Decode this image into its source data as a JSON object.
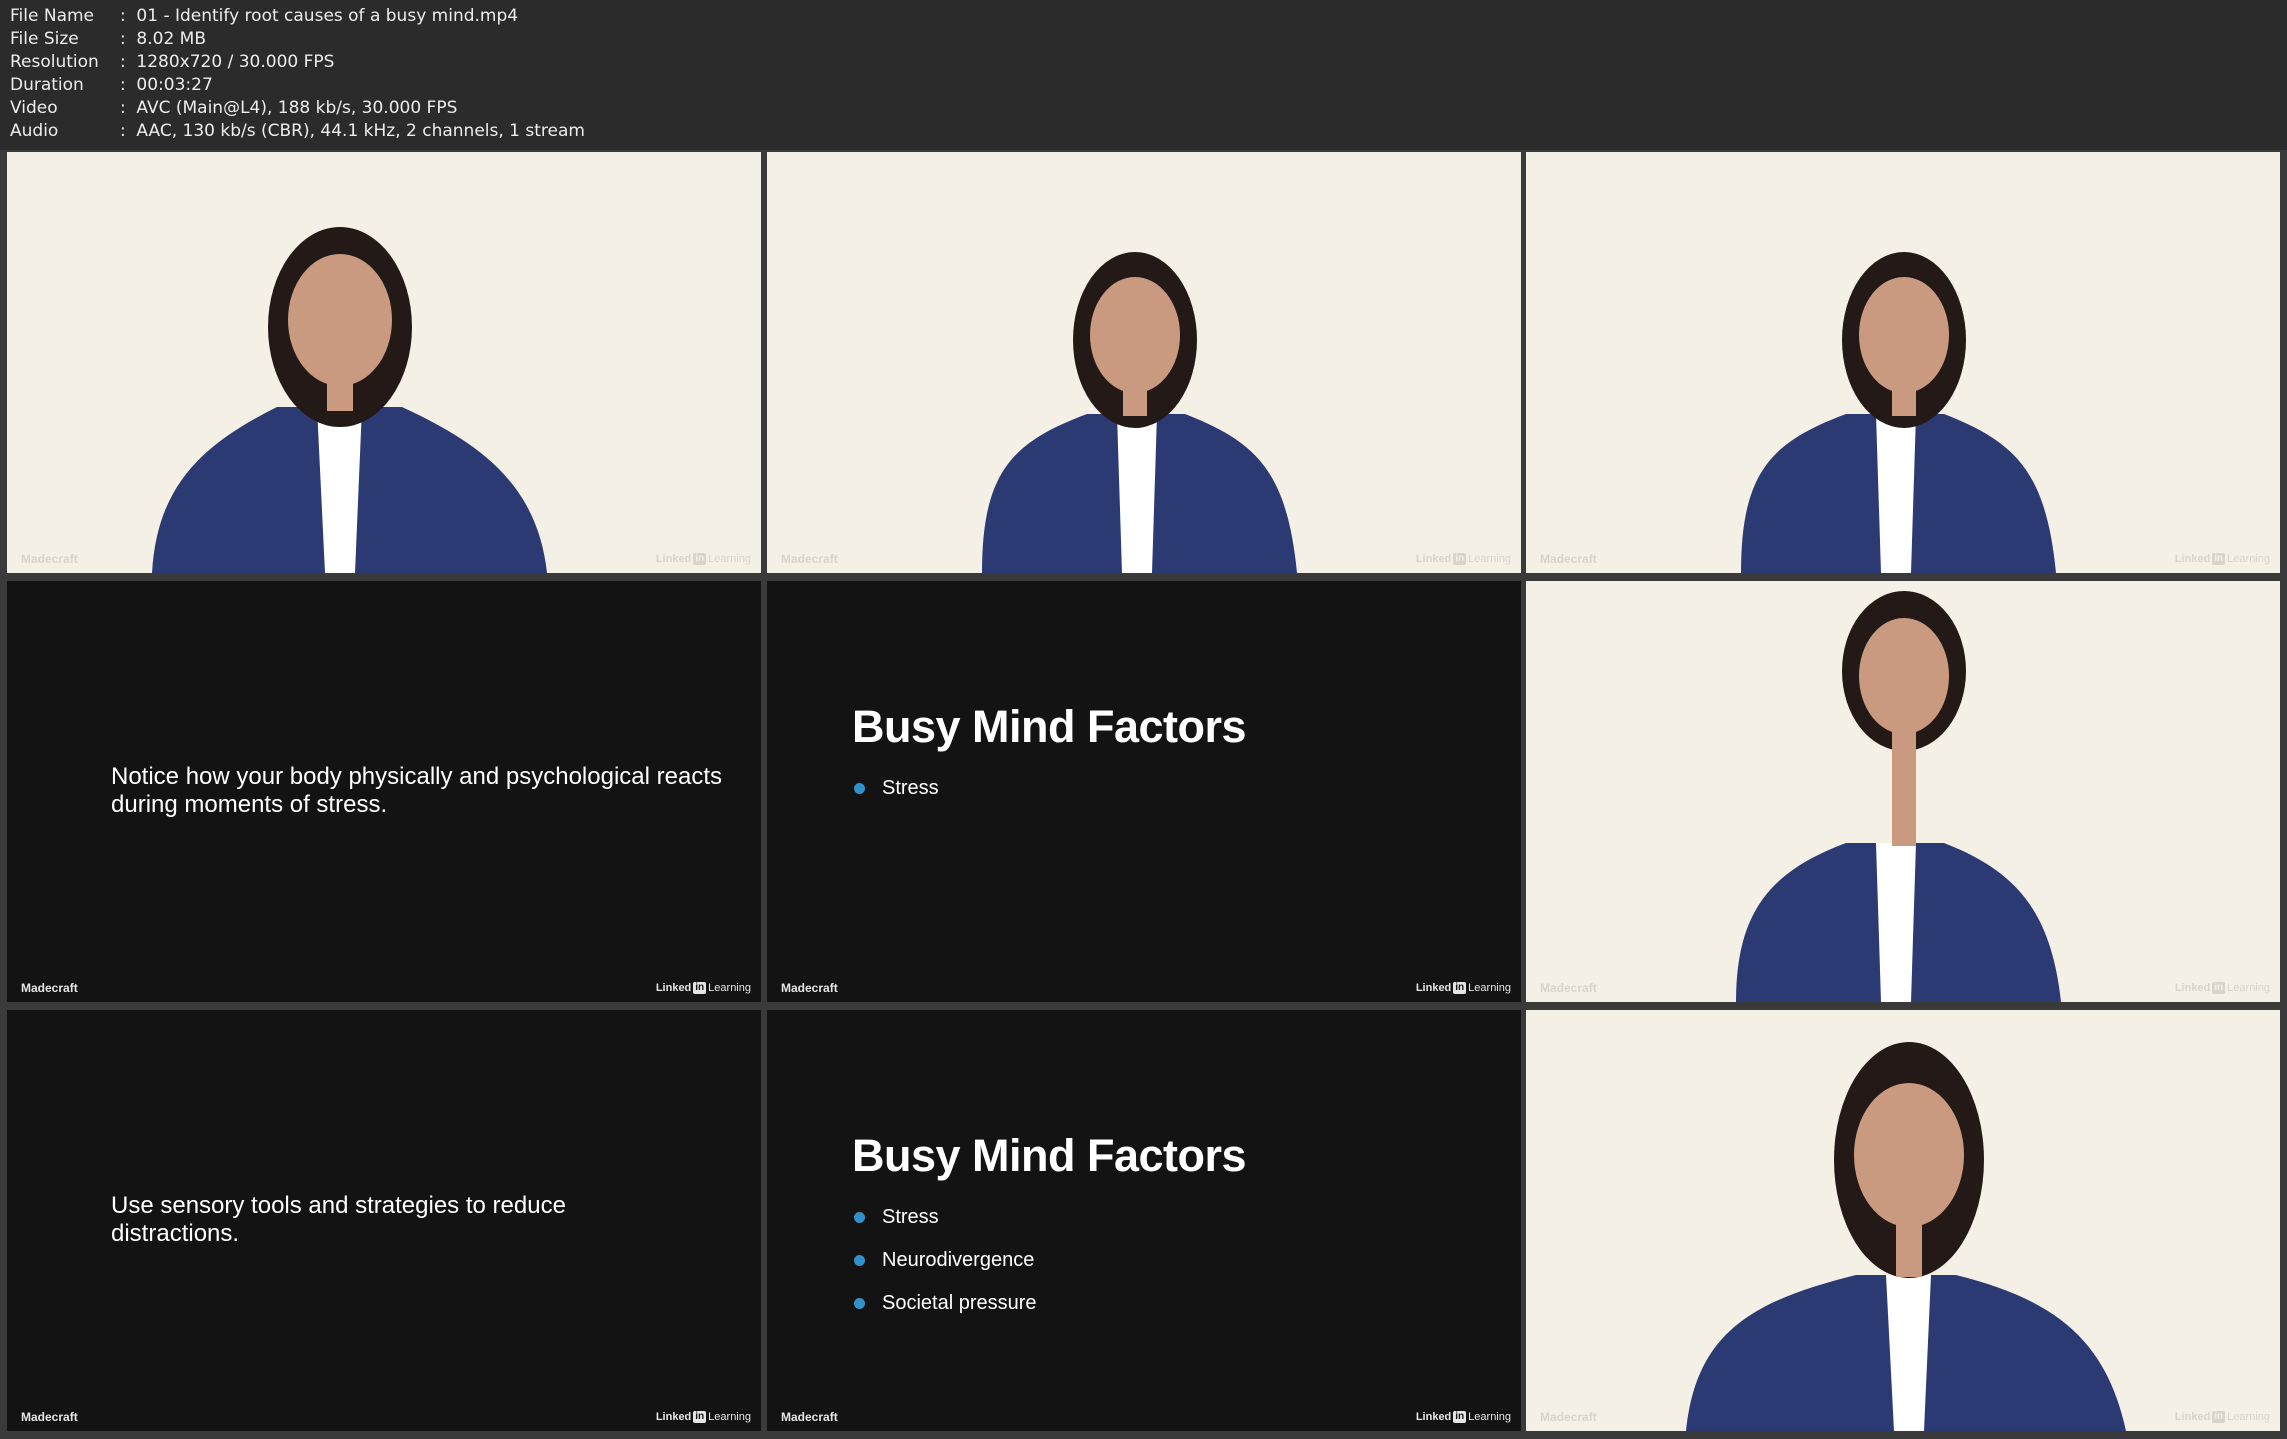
{
  "info": [
    {
      "label": "File Name",
      "value": "01 - Identify root causes of a busy mind.mp4"
    },
    {
      "label": "File Size",
      "value": "8.02 MB"
    },
    {
      "label": "Resolution",
      "value": "1280x720 / 30.000 FPS"
    },
    {
      "label": "Duration",
      "value": "00:03:27"
    },
    {
      "label": "Video",
      "value": "AVC (Main@L4), 188 kb/s, 30.000 FPS"
    },
    {
      "label": "Audio",
      "value": "AAC, 130 kb/s (CBR), 44.1 kHz, 2 channels, 1 stream"
    }
  ],
  "separator": ":",
  "watermark": {
    "left": "Madecraft",
    "right_a": "Linked",
    "right_in": "in",
    "right_b": "Learning"
  },
  "slides": {
    "quote1": "Notice how your body physically and psychological reacts during moments of stress.",
    "quote2": "Use sensory tools and strategies to reduce distractions.",
    "title": "Busy Mind Factors",
    "bullets_short": [
      "Stress"
    ],
    "bullets_full": [
      "Stress",
      "Neurodivergence",
      "Societal pressure"
    ]
  },
  "colors": {
    "header_bg": "#2b2b2b",
    "video_bg": "#f4f0e6",
    "slide_bg": "#131314",
    "bullet_accent": "#2f93c9",
    "blazer": "#2c3a73"
  },
  "icons": [
    "person-figure-icon",
    "linkedin-logo-icon"
  ]
}
